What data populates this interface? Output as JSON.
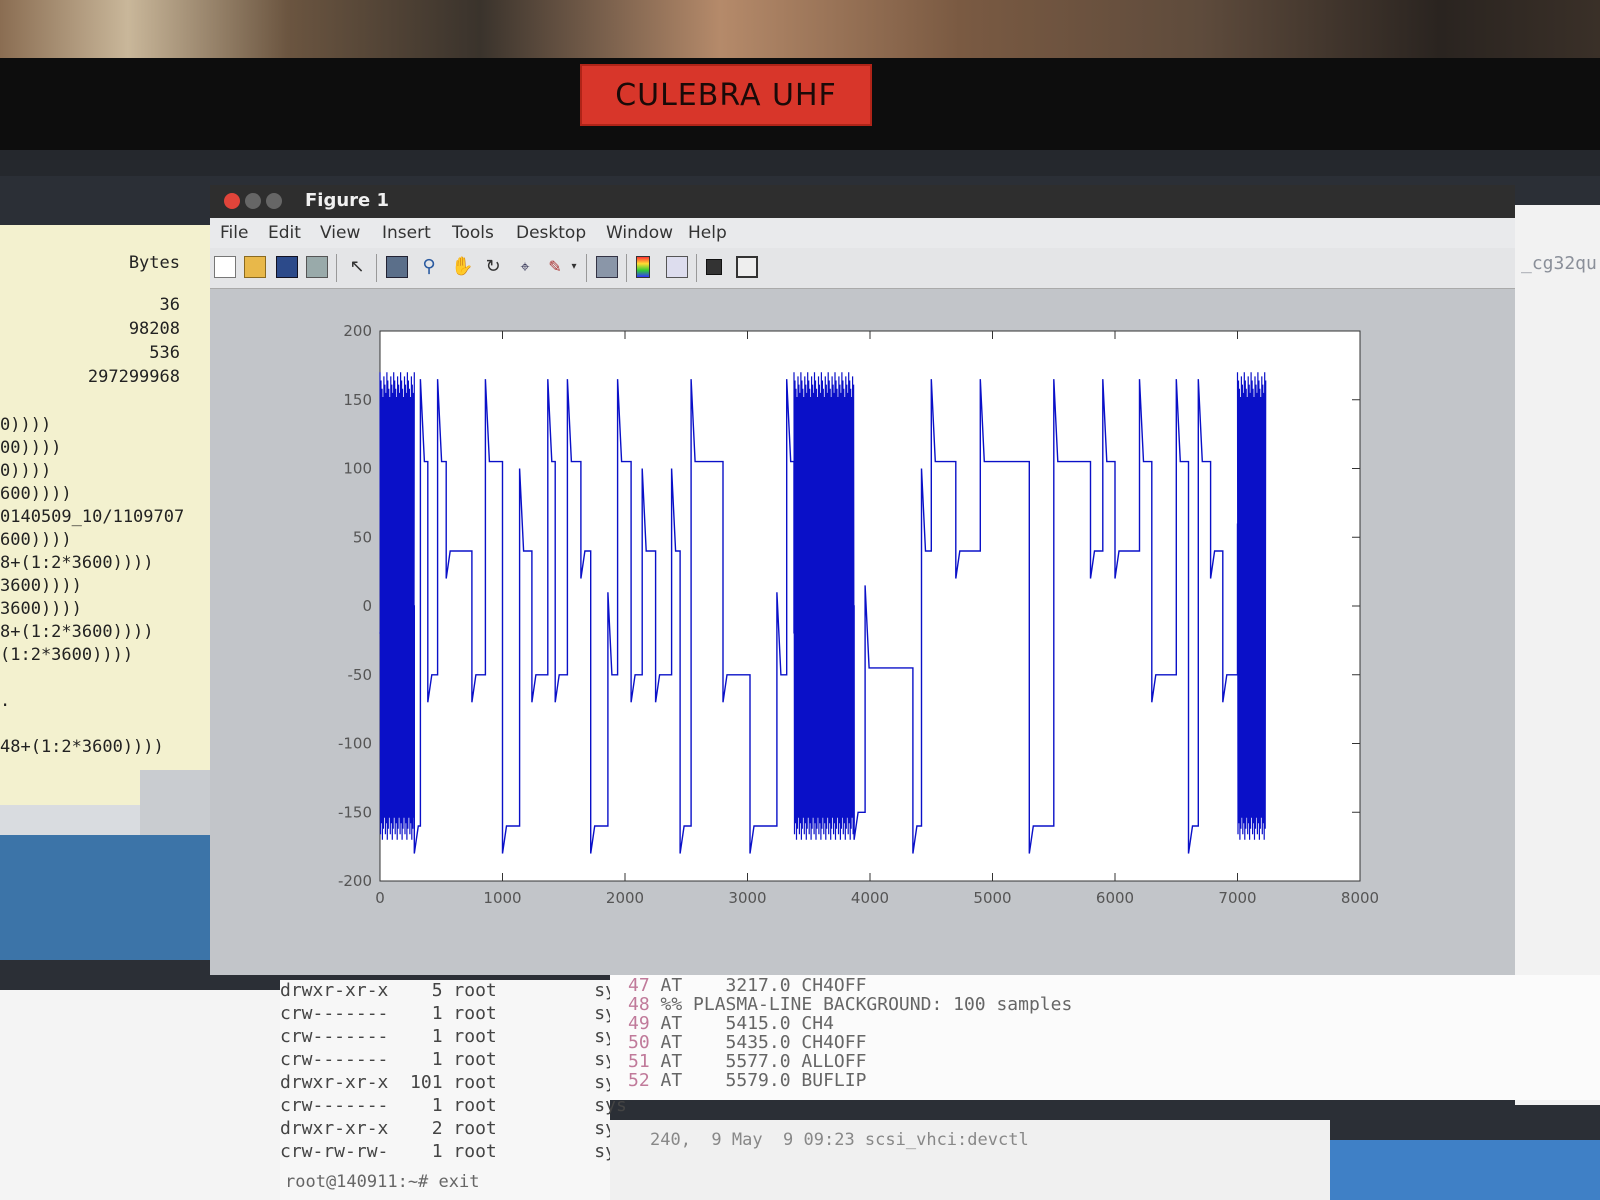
{
  "plate": {
    "text": "CULEBRA UHF"
  },
  "figure": {
    "title": "Figure 1",
    "menu": [
      "File",
      "Edit",
      "View",
      "Insert",
      "Tools",
      "Desktop",
      "Window",
      "Help"
    ],
    "toolbar_icons": [
      "new-file-icon",
      "open-folder-icon",
      "save-icon",
      "print-icon",
      "pointer-icon",
      "zoom-in-icon",
      "zoom-out-icon",
      "pan-hand-icon",
      "rotate-icon",
      "data-cursor-icon",
      "brush-icon",
      "dropdown-arrow-icon",
      "link-plot-icon",
      "colorbar-icon",
      "legend-icon",
      "hide-plot-tools-icon",
      "show-plot-tools-icon"
    ],
    "colors": {
      "line": "#0a10c8",
      "axes_bg": "#ffffff",
      "figure_bg": "#c2c5c9"
    }
  },
  "chart_data": {
    "type": "line",
    "title": "",
    "xlabel": "",
    "ylabel": "",
    "xlim": [
      0,
      8000
    ],
    "ylim": [
      -200,
      200
    ],
    "xticks": [
      0,
      1000,
      2000,
      3000,
      4000,
      5000,
      6000,
      7000,
      8000
    ],
    "yticks": [
      -200,
      -150,
      -100,
      -50,
      0,
      50,
      100,
      150,
      200
    ],
    "grid": false,
    "series": [
      {
        "segments": [
          [
            0,
            280,
            0
          ],
          [
            280,
            330,
            -160
          ],
          [
            330,
            390,
            105
          ],
          [
            390,
            470,
            -50
          ],
          [
            470,
            540,
            105
          ],
          [
            540,
            750,
            40
          ],
          [
            750,
            860,
            -50
          ],
          [
            860,
            1000,
            105
          ],
          [
            1000,
            1140,
            -160
          ],
          [
            1140,
            1240,
            40
          ],
          [
            1240,
            1370,
            -50
          ],
          [
            1370,
            1430,
            105
          ],
          [
            1430,
            1530,
            -50
          ],
          [
            1530,
            1640,
            105
          ],
          [
            1640,
            1720,
            40
          ],
          [
            1720,
            1860,
            -160
          ],
          [
            1860,
            1940,
            -50
          ],
          [
            1940,
            2050,
            105
          ],
          [
            2050,
            2140,
            -50
          ],
          [
            2140,
            2250,
            40
          ],
          [
            2250,
            2380,
            -50
          ],
          [
            2380,
            2450,
            40
          ],
          [
            2450,
            2540,
            -160
          ],
          [
            2540,
            2800,
            105
          ],
          [
            2800,
            3020,
            -50
          ],
          [
            3020,
            3240,
            -160
          ],
          [
            3240,
            3320,
            -50
          ],
          [
            3320,
            3380,
            105
          ],
          [
            3380,
            3870,
            0
          ],
          [
            3870,
            3960,
            -150
          ],
          [
            3960,
            4350,
            -45
          ],
          [
            4350,
            4420,
            -160
          ],
          [
            4420,
            4500,
            40
          ],
          [
            4500,
            4700,
            105
          ],
          [
            4700,
            4900,
            40
          ],
          [
            4900,
            5300,
            105
          ],
          [
            5300,
            5500,
            -160
          ],
          [
            5500,
            5800,
            105
          ],
          [
            5800,
            5900,
            40
          ],
          [
            5900,
            6000,
            105
          ],
          [
            6000,
            6200,
            40
          ],
          [
            6200,
            6300,
            105
          ],
          [
            6300,
            6500,
            -50
          ],
          [
            6500,
            6600,
            105
          ],
          [
            6600,
            6680,
            -160
          ],
          [
            6680,
            6780,
            105
          ],
          [
            6780,
            6880,
            40
          ],
          [
            6880,
            7000,
            -50
          ],
          [
            7000,
            7230,
            0
          ]
        ],
        "dense_bursts": [
          [
            0,
            280
          ],
          [
            3380,
            3870
          ],
          [
            7000,
            7230
          ]
        ]
      }
    ]
  },
  "left_terminal": {
    "header": "Bytes",
    "numbers": [
      "36",
      "98208",
      "536",
      "297299968"
    ],
    "code_lines": [
      "0))))",
      "00))))",
      "0))))",
      "600))))",
      "0140509_10/1109707",
      "600))))",
      "8+(1:2*3600))))",
      "3600))))",
      "3600))))",
      "8+(1:2*3600))))",
      "(1:2*3600))))",
      "",
      ".",
      "",
      "48+(1:2*3600))))"
    ]
  },
  "right_pane": {
    "ghost": "_cg32qu"
  },
  "ls_listing": [
    {
      "perm": "drwxr-xr-x",
      "n": "5",
      "user": "root",
      "group": "sys"
    },
    {
      "perm": "crw-------",
      "n": "1",
      "user": "root",
      "group": "sys"
    },
    {
      "perm": "crw-------",
      "n": "1",
      "user": "root",
      "group": "sys"
    },
    {
      "perm": "crw-------",
      "n": "1",
      "user": "root",
      "group": "sys"
    },
    {
      "perm": "drwxr-xr-x",
      "n": "101",
      "user": "root",
      "group": "sys"
    },
    {
      "perm": "crw-------",
      "n": "1",
      "user": "root",
      "group": "sys"
    },
    {
      "perm": "drwxr-xr-x",
      "n": "2",
      "user": "root",
      "group": "sys"
    },
    {
      "perm": "crw-rw-rw-",
      "n": "1",
      "user": "root",
      "group": "sys"
    }
  ],
  "at_lines": [
    {
      "n": "47",
      "text": "AT    3217.0 CH4OFF"
    },
    {
      "n": "48",
      "text": "%% PLASMA-LINE BACKGROUND: 100 samples"
    },
    {
      "n": "49",
      "text": "AT    5415.0 CH4"
    },
    {
      "n": "50",
      "text": "AT    5435.0 CH4OFF"
    },
    {
      "n": "51",
      "text": "AT    5577.0 ALLOFF"
    },
    {
      "n": "52",
      "text": "AT    5579.0 BUFLIP"
    }
  ],
  "bottom_line": "240,  9 May  9 09:23 scsi_vhci:devctl",
  "prompt_line": "root@140911:~# exit"
}
